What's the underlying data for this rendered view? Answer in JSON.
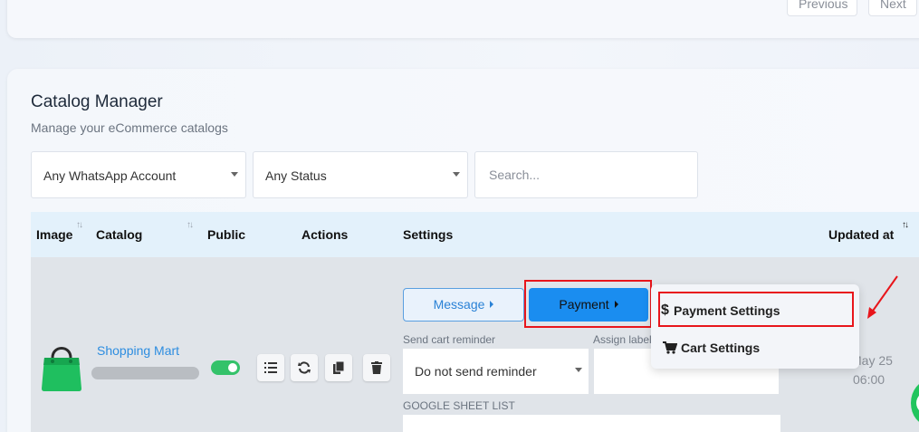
{
  "pagination": {
    "previous_label": "Previous",
    "next_label": "Next"
  },
  "page": {
    "title": "Catalog Manager",
    "subtitle": "Manage your eCommerce catalogs"
  },
  "filters": {
    "account_value": "Any WhatsApp Account",
    "status_value": "Any Status",
    "search_placeholder": "Search..."
  },
  "table": {
    "columns": {
      "image": "Image",
      "catalog": "Catalog",
      "public": "Public",
      "actions": "Actions",
      "settings": "Settings",
      "updated_at": "Updated at"
    },
    "row": {
      "catalog_name": "Shopping Mart",
      "public_enabled": true,
      "message_label": "Message",
      "payment_label": "Payment",
      "send_cart_reminder_label": "Send cart reminder",
      "send_cart_reminder_value": "Do not send reminder",
      "assign_label_label": "Assign label",
      "google_sheet_list_label": "GOOGLE SHEET LIST",
      "updated_line1": "May 25",
      "updated_line2": "06:00"
    }
  },
  "payment_menu": {
    "items": [
      {
        "label": "Payment Settings",
        "icon": "dollar-icon"
      },
      {
        "label": "Cart Settings",
        "icon": "cart-icon"
      }
    ]
  },
  "colors": {
    "accent": "#1a8df0",
    "highlight": "#e8151b",
    "toggle_on": "#34c26a",
    "link": "#2d8de0"
  }
}
